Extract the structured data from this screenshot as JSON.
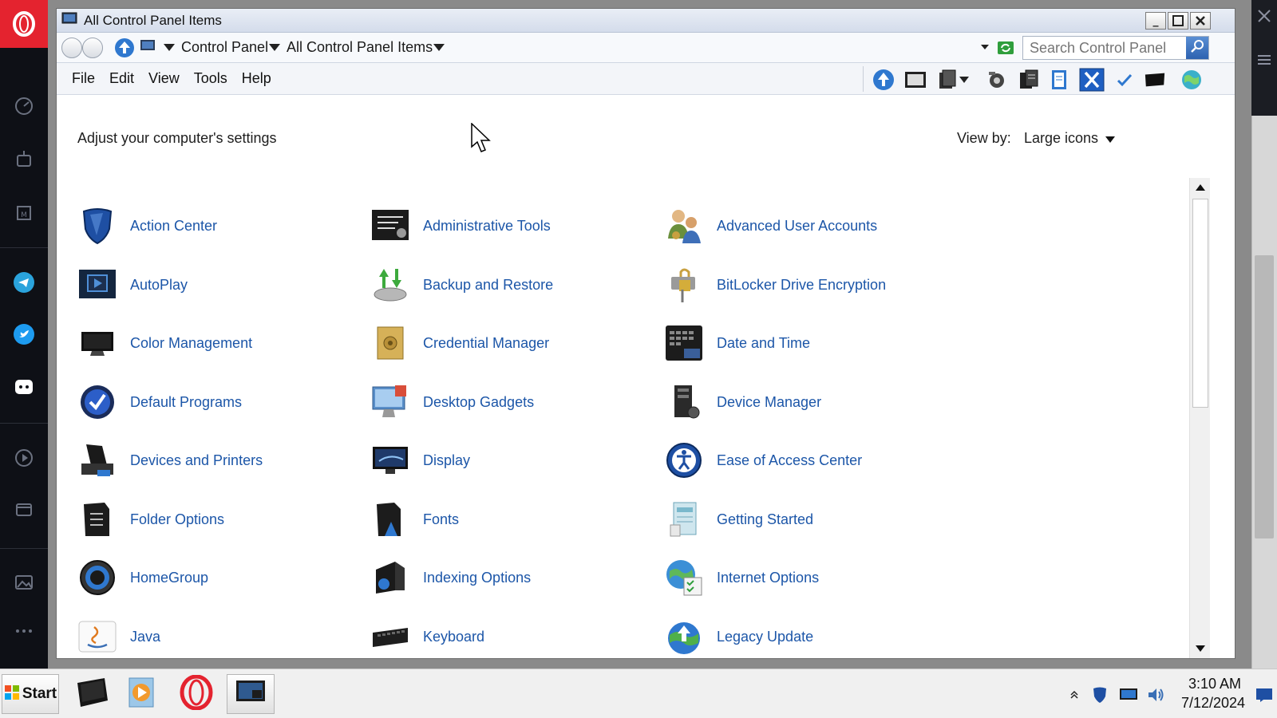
{
  "window": {
    "title": "All Control Panel Items"
  },
  "address": {
    "crumbs": [
      "Control Panel",
      "All Control Panel Items"
    ],
    "search_placeholder": "Search Control Panel"
  },
  "menu": [
    "File",
    "Edit",
    "View",
    "Tools",
    "Help"
  ],
  "content": {
    "heading": "Adjust your computer's settings",
    "view_by_label": "View by:",
    "view_by_value": "Large icons"
  },
  "items": [
    {
      "label": "Action Center",
      "icon": "shield-icon"
    },
    {
      "label": "Administrative Tools",
      "icon": "admin-tools-icon"
    },
    {
      "label": "Advanced User Accounts",
      "icon": "users-icon"
    },
    {
      "label": "AutoPlay",
      "icon": "autoplay-icon"
    },
    {
      "label": "Backup and Restore",
      "icon": "backup-icon"
    },
    {
      "label": "BitLocker Drive Encryption",
      "icon": "bitlocker-icon"
    },
    {
      "label": "Color Management",
      "icon": "color-management-icon"
    },
    {
      "label": "Credential Manager",
      "icon": "vault-icon"
    },
    {
      "label": "Date and Time",
      "icon": "calendar-clock-icon"
    },
    {
      "label": "Default Programs",
      "icon": "check-circle-icon"
    },
    {
      "label": "Desktop Gadgets",
      "icon": "gadgets-icon"
    },
    {
      "label": "Device Manager",
      "icon": "device-manager-icon"
    },
    {
      "label": "Devices and Printers",
      "icon": "printer-icon"
    },
    {
      "label": "Display",
      "icon": "display-icon"
    },
    {
      "label": "Ease of Access Center",
      "icon": "ease-of-access-icon"
    },
    {
      "label": "Folder Options",
      "icon": "folder-options-icon"
    },
    {
      "label": "Fonts",
      "icon": "fonts-icon"
    },
    {
      "label": "Getting Started",
      "icon": "getting-started-icon"
    },
    {
      "label": "HomeGroup",
      "icon": "homegroup-icon"
    },
    {
      "label": "Indexing Options",
      "icon": "indexing-icon"
    },
    {
      "label": "Internet Options",
      "icon": "globe-icon"
    },
    {
      "label": "Java",
      "icon": "java-icon"
    },
    {
      "label": "Keyboard",
      "icon": "keyboard-icon"
    },
    {
      "label": "Legacy Update",
      "icon": "legacy-update-icon"
    }
  ],
  "taskbar": {
    "start_label": "Start",
    "time": "3:10 AM",
    "date": "7/12/2024"
  },
  "colors": {
    "link": "#1c56a8",
    "opera_red": "#e4232f",
    "sidebar": "#0e1016"
  }
}
